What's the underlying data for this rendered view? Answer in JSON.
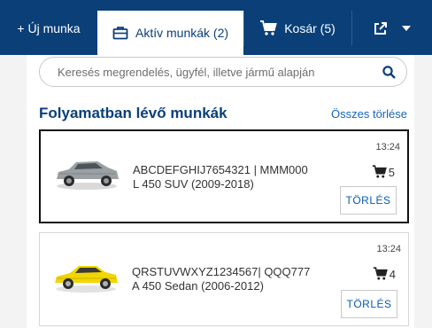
{
  "tabs": {
    "new_work": "+ Új munka",
    "active_work": "Aktív munkák (2)",
    "cart": "Kosár (5)"
  },
  "search": {
    "placeholder": "Keresés megrendelés, ügyfél, illetve jármű alapján"
  },
  "section": {
    "title": "Folyamatban lévő munkák",
    "clear_all": "Összes törlése"
  },
  "jobs": [
    {
      "time": "13:24",
      "line1": "ABCDEFGHIJ7654321 | MMM000",
      "line2": "L 450 SUV (2009-2018)",
      "cart_count": "5",
      "delete_label": "TÖRLÉS",
      "car_color": "#9aa0a4"
    },
    {
      "time": "13:24",
      "line1": "QRSTUVWXYZ1234567| QQQ777",
      "line2": "A 450 Sedan (2006-2012)",
      "cart_count": "4",
      "delete_label": "TÖRLÉS",
      "car_color": "#f2d600"
    }
  ],
  "colors": {
    "brand_navy": "#0a3f78",
    "link_blue": "#1565c0"
  },
  "icons": {
    "active_tab": "briefcase-icon",
    "cart": "cart-icon",
    "share": "share-icon",
    "dropdown": "chevron-down-icon",
    "search": "search-icon"
  }
}
